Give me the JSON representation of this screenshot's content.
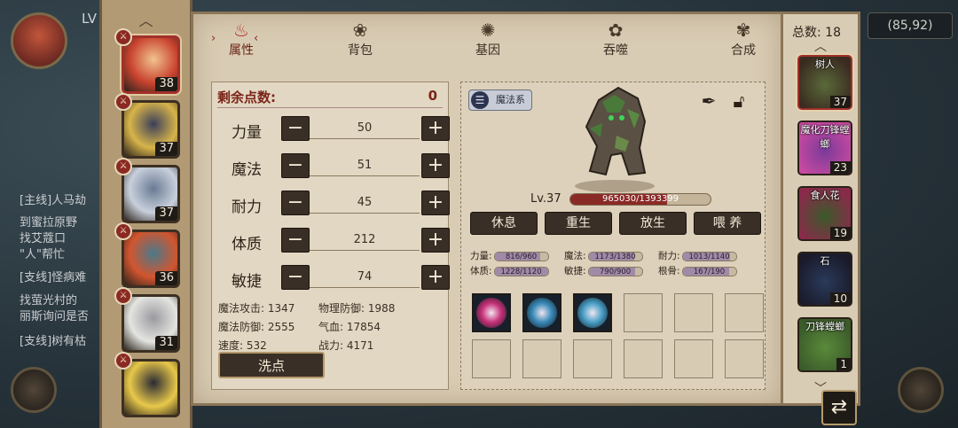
{
  "background": {
    "level_prefix": "LV",
    "coords": "(85,92)",
    "quest_lines": [
      "[主线]人马劫",
      "到蜜拉原野",
      "找艾蔻口",
      "\"人\"帮忙",
      "[支线]怪病难",
      "找萤光村的",
      "丽斯询问是否",
      "[支线]树有枯"
    ]
  },
  "roster": {
    "up_arrow": "︿",
    "heroes": [
      {
        "level": "38",
        "colors": [
          "#c9432f",
          "#f1c38e"
        ],
        "active": true
      },
      {
        "level": "37",
        "colors": [
          "#d8b44a",
          "#3a3f5a"
        ],
        "active": false
      },
      {
        "level": "37",
        "colors": [
          "#c8d0dc",
          "#6a7a94"
        ],
        "active": false
      },
      {
        "level": "36",
        "colors": [
          "#d2552f",
          "#4a7a8a"
        ],
        "active": false
      },
      {
        "level": "31",
        "colors": [
          "#e4e4e0",
          "#9a9aa0"
        ],
        "active": false
      },
      {
        "level": "",
        "colors": [
          "#e8c84a",
          "#2a2a34"
        ],
        "active": false
      }
    ]
  },
  "tabs": [
    {
      "label": "属性",
      "icon": "flame-icon",
      "glyph": "♨",
      "active": true
    },
    {
      "label": "背包",
      "icon": "bag-icon",
      "glyph": "❀",
      "active": false
    },
    {
      "label": "基因",
      "icon": "gene-icon",
      "glyph": "✺",
      "active": false
    },
    {
      "label": "吞噬",
      "icon": "devour-icon",
      "glyph": "✿",
      "active": false
    },
    {
      "label": "合成",
      "icon": "synthesis-icon",
      "glyph": "✾",
      "active": false
    }
  ],
  "attributes": {
    "points_label": "剩余点数:",
    "points_value": "0",
    "stats": [
      {
        "label": "力量",
        "value": "50"
      },
      {
        "label": "魔法",
        "value": "51"
      },
      {
        "label": "耐力",
        "value": "45"
      },
      {
        "label": "体质",
        "value": "212"
      },
      {
        "label": "敏捷",
        "value": "74"
      }
    ],
    "minus": "−",
    "plus": "+",
    "derived": [
      {
        "text": "魔法攻击: 1347"
      },
      {
        "text": "物理防御: 1988"
      },
      {
        "text": "魔法防御: 2555"
      },
      {
        "text": "气血: 17854"
      },
      {
        "text": "速度: 532"
      },
      {
        "text": "战力: 4171"
      }
    ],
    "reset_label": "洗点"
  },
  "monster": {
    "school_label": "魔法系",
    "school_icon": "list-icon",
    "level": "Lv.37",
    "hp_text": "965030/1393399",
    "hp_fraction": 0.69,
    "actions": [
      "休息",
      "重生",
      "放生",
      "喂 养"
    ],
    "mini_stats": [
      {
        "label": "力量:",
        "text": "816/960",
        "fraction": 0.85
      },
      {
        "label": "魔法:",
        "text": "1173/1380",
        "fraction": 0.85
      },
      {
        "label": "耐力:",
        "text": "1013/1140",
        "fraction": 0.89
      },
      {
        "label": "体质:",
        "text": "1228/1120",
        "fraction": 1.0
      },
      {
        "label": "敏捷:",
        "text": "790/900",
        "fraction": 0.88
      },
      {
        "label": "根骨:",
        "text": "167/190",
        "fraction": 0.88
      }
    ],
    "skills_filled": 3,
    "skill_colors": [
      "#c8327a",
      "#3a8ab8",
      "#4aa0c8"
    ]
  },
  "right_bar": {
    "total_label": "总数: 18",
    "up_arrow": "︿",
    "down_arrow": "﹀",
    "monsters": [
      {
        "name": "树人",
        "level": "37",
        "colors": [
          "#5a6a3a",
          "#3a2a20"
        ],
        "active": true
      },
      {
        "name": "魔化刀锋螳螂",
        "level": "23",
        "colors": [
          "#7a3a9a",
          "#c84aa0"
        ],
        "active": false
      },
      {
        "name": "食人花",
        "level": "19",
        "colors": [
          "#3a5a2a",
          "#8a2a4a"
        ],
        "active": false
      },
      {
        "name": "石",
        "level": "10",
        "colors": [
          "#2a3a5a",
          "#1a1a2a"
        ],
        "active": false
      },
      {
        "name": "刀锋螳螂",
        "level": "1",
        "colors": [
          "#5a8a3a",
          "#3a5a2a"
        ],
        "active": false
      }
    ],
    "exit_glyph": "⇄"
  }
}
